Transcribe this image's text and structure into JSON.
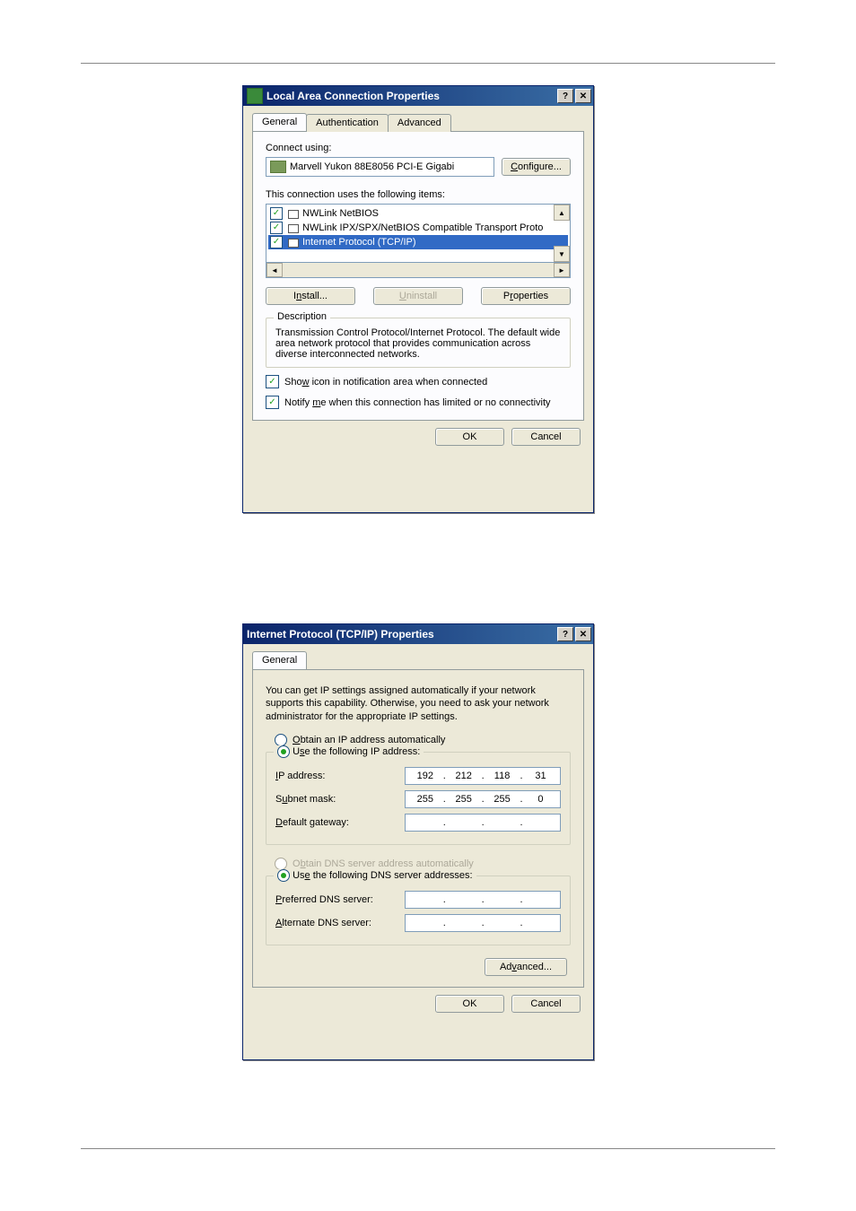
{
  "dialog1": {
    "title": "Local Area Connection Properties",
    "tabs": [
      "General",
      "Authentication",
      "Advanced"
    ],
    "connect_using_label": "Connect using:",
    "adapter": "Marvell Yukon 88E8056 PCI-E Gigabi",
    "configure_btn": "Configure...",
    "items_label": "This connection uses the following items:",
    "items": [
      {
        "checked": true,
        "label": "NWLink NetBIOS",
        "selected": false
      },
      {
        "checked": true,
        "label": "NWLink IPX/SPX/NetBIOS Compatible Transport Proto",
        "selected": false
      },
      {
        "checked": true,
        "label": "Internet Protocol (TCP/IP)",
        "selected": true
      }
    ],
    "install_btn": "Install...",
    "uninstall_btn": "Uninstall",
    "properties_btn": "Properties",
    "description_title": "Description",
    "description_text": "Transmission Control Protocol/Internet Protocol. The default wide area network protocol that provides communication across diverse interconnected networks.",
    "show_icon_label": "Show icon in notification area when connected",
    "notify_label": "Notify me when this connection has limited or no connectivity",
    "ok_btn": "OK",
    "cancel_btn": "Cancel"
  },
  "dialog2": {
    "title": "Internet Protocol (TCP/IP) Properties",
    "tab": "General",
    "intro": "You can get IP settings assigned automatically if your network supports this capability. Otherwise, you need to ask your network administrator for the appropriate IP settings.",
    "radio_auto_ip": "Obtain an IP address automatically",
    "radio_manual_ip": "Use the following IP address:",
    "ip_label": "IP address:",
    "ip_value": [
      "192",
      "212",
      "118",
      "31"
    ],
    "subnet_label": "Subnet mask:",
    "subnet_value": [
      "255",
      "255",
      "255",
      "0"
    ],
    "gateway_label": "Default gateway:",
    "gateway_value": [
      "",
      "",
      "",
      ""
    ],
    "radio_auto_dns": "Obtain DNS server address automatically",
    "radio_manual_dns": "Use the following DNS server addresses:",
    "preferred_dns_label": "Preferred DNS server:",
    "preferred_dns_value": [
      "",
      "",
      "",
      ""
    ],
    "alternate_dns_label": "Alternate DNS server:",
    "alternate_dns_value": [
      "",
      "",
      "",
      ""
    ],
    "advanced_btn": "Advanced...",
    "ok_btn": "OK",
    "cancel_btn": "Cancel"
  }
}
